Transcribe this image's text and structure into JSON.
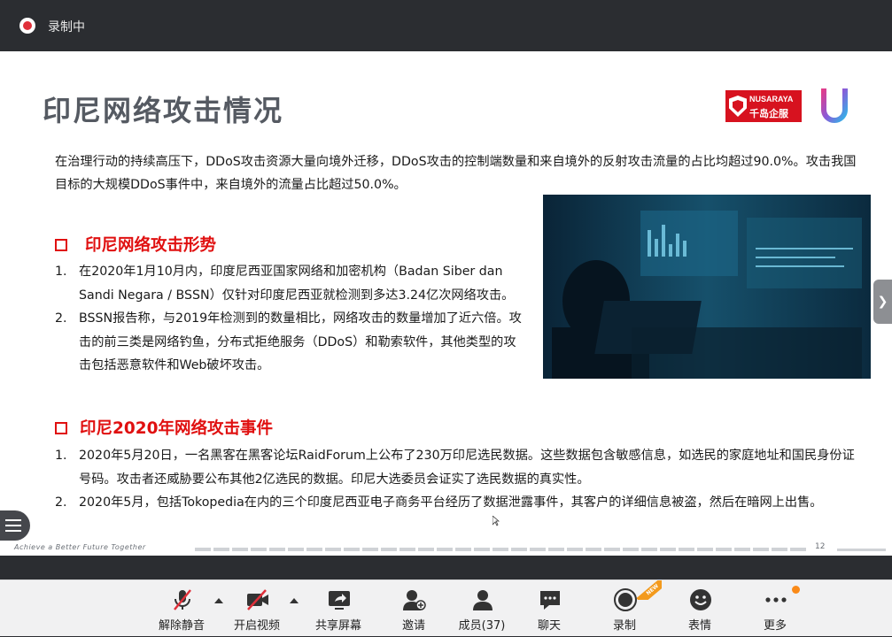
{
  "recording": {
    "label": "录制中"
  },
  "slide": {
    "title": "印尼网络攻击情况",
    "logo": {
      "brand_en": "NUSARAYA",
      "brand_cn": "千岛企服"
    },
    "intro": "在治理行动的持续高压下，DDoS攻击资源大量向境外迁移，DDoS攻击的控制端数量和来自境外的反射攻击流量的占比均超过90.0%。攻击我国目标的大规模DDoS事件中，来自境外的流量占比超过50.0%。",
    "section1": {
      "heading": "印尼网络攻击形势",
      "items": [
        {
          "num": "1.",
          "text": "在2020年1月10月内，印度尼西亚国家网络和加密机构（Badan Siber dan Sandi Negara / BSSN）仅针对印度尼西亚就检测到多达3.24亿次网络攻击。"
        },
        {
          "num": "2.",
          "text": "BSSN报告称，与2019年检测到的数量相比，网络攻击的数量增加了近六倍。攻击的前三类是网络钓鱼，分布式拒绝服务（DDoS）和勒索软件，其他类型的攻击包括恶意软件和Web破坏攻击。"
        }
      ]
    },
    "section2": {
      "heading": "印尼2020年网络攻击事件",
      "items": [
        {
          "num": "1.",
          "text": "2020年5月20日，一名黑客在黑客论坛RaidForum上公布了230万印尼选民数据。这些数据包含敏感信息，如选民的家庭地址和国民身份证号码。攻击者还威胁要公布其他2亿选民的数据。印尼大选委员会证实了选民数据的真实性。"
        },
        {
          "num": "2.",
          "text": "2020年5月，包括Tokopedia在内的三个印度尼西亚电子商务平台经历了数据泄露事件，其客户的详细信息被盗，然后在暗网上出售。"
        }
      ]
    },
    "footer": {
      "tagline": "Achieve a Better Future Together",
      "page": "12"
    }
  },
  "toolbar": {
    "mute": "解除静音",
    "video": "开启视频",
    "share": "共享屏幕",
    "invite": "邀请",
    "members": "成员(37)",
    "chat": "聊天",
    "record": "录制",
    "record_badge": "NEW",
    "reactions": "表情",
    "more": "更多"
  },
  "colors": {
    "accent_red": "#e01010",
    "recording_red": "#e0303a",
    "notify_orange": "#fa8a18"
  }
}
